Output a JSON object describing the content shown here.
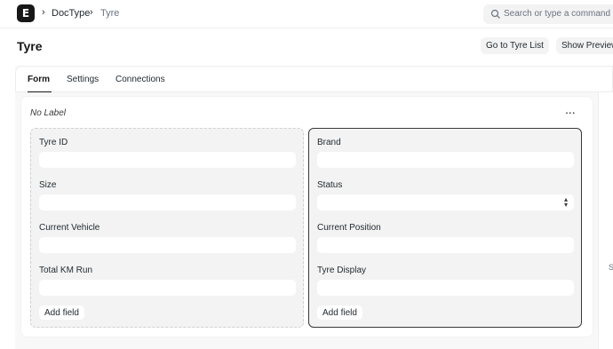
{
  "navbar": {
    "logo_letter": "E",
    "breadcrumbs": [
      "DocType",
      "Tyre"
    ],
    "search_placeholder": "Search or type a command (Ctrl + G)"
  },
  "header": {
    "title": "Tyre",
    "go_to_list_label": "Go to Tyre List",
    "show_preview_label": "Show Preview"
  },
  "tabs": [
    {
      "label": "Form",
      "active": true
    },
    {
      "label": "Settings",
      "active": false
    },
    {
      "label": "Connections",
      "active": false
    }
  ],
  "section": {
    "label": "No Label",
    "menu": "..."
  },
  "left_column": {
    "fields": [
      {
        "label": "Tyre ID",
        "type": "text"
      },
      {
        "label": "Size",
        "type": "text"
      },
      {
        "label": "Current Vehicle",
        "type": "text"
      },
      {
        "label": "Total KM Run",
        "type": "text"
      }
    ],
    "add_field_label": "Add field"
  },
  "right_column": {
    "fields": [
      {
        "label": "Brand",
        "type": "text"
      },
      {
        "label": "Status",
        "type": "select"
      },
      {
        "label": "Current Position",
        "type": "text"
      },
      {
        "label": "Tyre Display",
        "type": "text"
      }
    ],
    "add_field_label": "Add field"
  },
  "sidebar_peek_text": "S"
}
